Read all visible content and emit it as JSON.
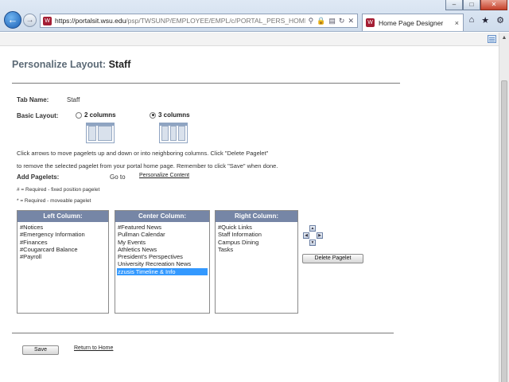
{
  "browser": {
    "url_host": "https://portalsit.wsu.edu",
    "url_path": "/psp/TWSUNP/EMPLOYEE/EMPL/c/PORTAL_PERS_HOMEPAGE.P(",
    "tab_title": "Home Page Designer",
    "back_glyph": "←",
    "forward_glyph": "→",
    "close_tab_glyph": "×",
    "home_glyph": "⌂",
    "fav_glyph": "★",
    "tools_glyph": "⚙",
    "window_min": "–",
    "window_max": "□",
    "window_close": "✕",
    "addr_tools": [
      "⚲",
      "🔒",
      "▤",
      "↻",
      "✕"
    ]
  },
  "page": {
    "title_prefix": "Personalize Layout:",
    "title_name": "Staff",
    "tab_name_label": "Tab Name:",
    "tab_name_value": "Staff",
    "basic_layout_label": "Basic Layout:",
    "layout_options": [
      {
        "label": "2 columns",
        "selected": false
      },
      {
        "label": "3 columns",
        "selected": true
      }
    ],
    "instructions_line1": "Click arrows to move pagelets up and down or into neighboring columns. Click \"Delete Pagelet\"",
    "instructions_line2": "to remove the selected pagelet from your portal home page. Remember to click \"Save\" when done.",
    "add_pagelets_label": "Add Pagelets:",
    "go_to_label": "Go to",
    "personalize_content_link": "Personalize Content",
    "legend_required_fixed": "# = Required - fixed position pagelet",
    "legend_required_moveable": "* = Required - moveable pagelet",
    "columns": [
      {
        "header": "Left Column:",
        "items": [
          "#Notices",
          "#Emergency Information",
          "#Finances",
          "#Cougarcard Balance",
          "#Payroll"
        ]
      },
      {
        "header": "Center Column:",
        "items": [
          "#Featured News",
          "Pullman Calendar",
          "My Events",
          "Athletics News",
          "President's Perspectives",
          "University Recreation News",
          "zzusis Timeline & Info"
        ],
        "selected_index": 6
      },
      {
        "header": "Right Column:",
        "items": [
          "#Quick Links",
          "Staff Information",
          "Campus Dining",
          "Tasks"
        ]
      }
    ],
    "arrow_glyphs": {
      "up": "▲",
      "down": "▼",
      "left": "◀",
      "right": "▶"
    },
    "delete_pagelet_label": "Delete Pagelet",
    "save_label": "Save",
    "return_home_link": "Return to Home"
  },
  "colors": {
    "panel_header": "#7686a6",
    "selection": "#3399ff",
    "title_prefix": "#5c6a76"
  }
}
